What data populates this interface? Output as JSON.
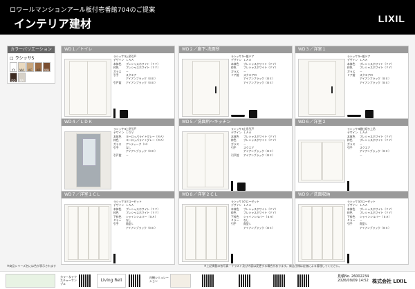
{
  "header": {
    "subtitle": "ロワールマンションアール板付壱番館704のご提案",
    "title": "インテリア建材",
    "logo": "LIXIL"
  },
  "sidebar": {
    "heading": "カラーバリエーション",
    "series": "ラシッサS",
    "swatches": [
      {
        "code": "YY",
        "color": "#ffffff"
      },
      {
        "code": "WA",
        "color": "#e9d9bf"
      },
      {
        "code": "AC",
        "color": "#c8a57c"
      },
      {
        "code": "AD",
        "color": "#9b6b43"
      },
      {
        "code": "WH",
        "color": "#7a4e31"
      },
      {
        "code": "DD",
        "color": "#3d2b22"
      },
      {
        "code": "RA",
        "color": "#d6d1c8"
      }
    ]
  },
  "cards": [
    {
      "title": "WD１／トイレ",
      "rows": [
        [
          "ラシッサＳ",
          "上吊引戸"
        ],
        [
          "デザイン",
          "ＬＡＡ"
        ],
        [
          "本体色",
          "プレシャスホワイト（ＹＹ）"
        ],
        [
          "枠色",
          "プレシャスホワイト（ＹＹ）"
        ],
        [
          "ガラス",
          "－"
        ],
        [
          "引手",
          "スクエア"
        ],
        [
          "",
          "アイアンブラック（ＢＥ）"
        ],
        [
          "引戸錠",
          "アイアンブラック（ＢＥ）"
        ]
      ]
    },
    {
      "title": "WD２／廊下-洗面所",
      "rows": [
        [
          "ラシッサＳ",
          "一般ドア"
        ],
        [
          "デザイン",
          "ＬＡＡ"
        ],
        [
          "本体色",
          "プレシャスホワイト（ＹＹ）"
        ],
        [
          "枠色",
          "プレシャスホワイト（ＹＹ）"
        ],
        [
          "ガラス",
          "－"
        ],
        [
          "ドア錠",
          "スクエアＭ"
        ],
        [
          "",
          "アイアンブラック（ＢＥ）"
        ],
        [
          "",
          "アイアンブラック（ＢＥ）"
        ]
      ]
    },
    {
      "title": "WD３／洋室１",
      "rows": [
        [
          "ラシッサＳ",
          "一般ドア"
        ],
        [
          "デザイン",
          "ＬＡＡ"
        ],
        [
          "本体色",
          "プレシャスホワイト（ＹＹ）"
        ],
        [
          "枠色",
          "プレシャスホワイト（ＹＹ）"
        ],
        [
          "ガラス",
          "－"
        ],
        [
          "ドア錠",
          "スクエアＭ"
        ],
        [
          "",
          "アイアンブラック（ＢＥ）"
        ],
        [
          "",
          "アイアンブラック（ＢＥ）"
        ]
      ]
    },
    {
      "title": "WD４／ＬＤＫ",
      "rows": [
        [
          "ラシッサＳ",
          "上吊引戸"
        ],
        [
          "デザイン",
          "ＬＧＶ"
        ],
        [
          "本体色",
          "ヨーロッパライトグレー（ＲＡ）"
        ],
        [
          "枠色",
          "ヨーロッパライトグレー（ＲＡ）"
        ],
        [
          "ガラス",
          "アンティーク（Ｈ）"
        ],
        [
          "引手",
          "なし"
        ],
        [
          "",
          "アイアンブラック（ＢＥ）"
        ],
        [
          "引戸錠",
          "－"
        ]
      ]
    },
    {
      "title": "WD５／洗面所～キッチン",
      "rows": [
        [
          "ラシッサＳ",
          "上吊引戸"
        ],
        [
          "デザイン",
          "ＬＡＡ"
        ],
        [
          "本体色",
          "プレシャスホワイト（ＹＹ）"
        ],
        [
          "枠色",
          "プレシャスホワイト（ＹＹ）"
        ],
        [
          "ガラス",
          "－"
        ],
        [
          "引手",
          "スクエア"
        ],
        [
          "",
          "アイアンブラック（ＢＥ）"
        ],
        [
          "引戸錠",
          "アイアンブラック（ＢＥ）"
        ]
      ]
    },
    {
      "title": "WD６／洋室２",
      "rows": [
        [
          "ラシッサＳ",
          "間仕切り上吊"
        ],
        [
          "デザイン",
          "ＬＡＡ"
        ],
        [
          "本体色",
          "プレシャスホワイト（ＹＹ）"
        ],
        [
          "枠色",
          "プレシャスホワイト（ＹＹ）"
        ],
        [
          "ガラス",
          "－"
        ],
        [
          "引手",
          "スクエア"
        ],
        [
          "",
          "アイアンブラック（ＢＥ）"
        ],
        [
          "",
          "－"
        ]
      ]
    },
    {
      "title": "WD７／洋室１ＣＬ",
      "rows": [
        [
          "ラシッサＳ",
          "クローゼット"
        ],
        [
          "デザイン",
          "ＬＡＡ"
        ],
        [
          "本体色",
          "プレシャスホワイト（ＹＹ）"
        ],
        [
          "枠色",
          "プレシャスホワイト（ＹＹ）"
        ],
        [
          "下枠色",
          "シャインシルバー（ＳＡ）"
        ],
        [
          "ミラー",
          "なし"
        ],
        [
          "引手",
          "角型Ｌ"
        ],
        [
          "",
          "アイアンブラック（ＢＥ）"
        ]
      ]
    },
    {
      "title": "WD８／洋室２ＣＬ",
      "rows": [
        [
          "ラシッサＳ",
          "クローゼット"
        ],
        [
          "デザイン",
          "ＬＡＡ"
        ],
        [
          "本体色",
          "プレシャスホワイト（ＹＹ）"
        ],
        [
          "枠色",
          "プレシャスホワイト（ＹＹ）"
        ],
        [
          "下枠色",
          "シャインシルバー（ＳＡ）"
        ],
        [
          "ミラー",
          "なし"
        ],
        [
          "引手",
          "角型Ｌ"
        ],
        [
          "",
          "アイアンブラック（ＢＥ）"
        ]
      ]
    },
    {
      "title": "WD９／洗面収納",
      "rows": [
        [
          "ラシッサＳ",
          "クローゼット"
        ],
        [
          "デザイン",
          "ＬＡＡ"
        ],
        [
          "本体色",
          "プレシャスホワイト（ＹＹ）"
        ],
        [
          "枠色",
          "プレシャスホワイト（ＹＹ）"
        ],
        [
          "下枠色",
          "シャインシルバー（ＳＡ）"
        ],
        [
          "ミラー",
          "－"
        ],
        [
          "引手",
          "角型Ｌ"
        ],
        [
          "",
          "アイアンブラック（ＢＥ）"
        ]
      ]
    }
  ],
  "notes": {
    "left": "※商品シリーズ名には色が表示されます",
    "center": "※上記掲載の各写真・イラスト及び内容は変更する場合があります。商品仕様は定価による管理してください。"
  },
  "footer": {
    "box1": "カラー＆テクスチャーサンプル",
    "box2": "Living Reli",
    "box3": "内観シミュレーション",
    "quote_no": "見積No. 26002234",
    "quote_date": "2026/09/09 14:52",
    "corp": "株式会社 LIXIL"
  }
}
